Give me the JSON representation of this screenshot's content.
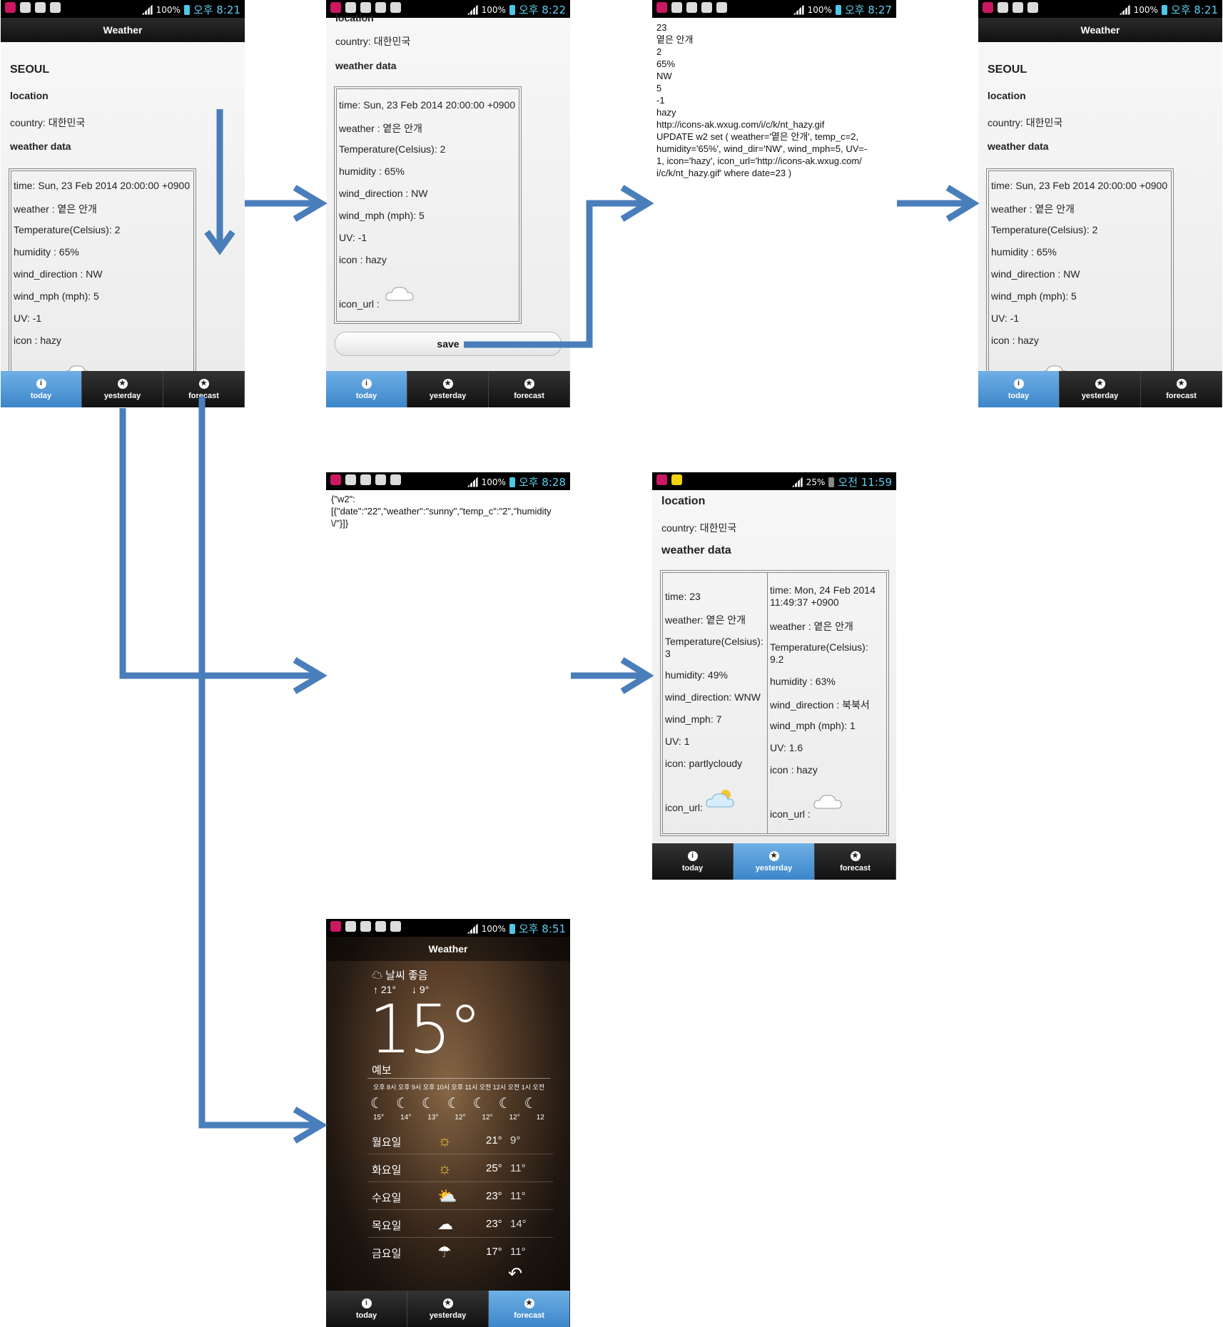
{
  "status": {
    "battery_full": "100%",
    "battery_low": "25%",
    "time_821": "오후 8:21",
    "time_822": "오후 8:22",
    "time_827": "오후 8:27",
    "time_828": "오후 8:28",
    "time_1159": "오전 11:59",
    "time_851": "오후 8:51"
  },
  "app": {
    "title": "Weather"
  },
  "tabs": {
    "today": "today",
    "yesterday": "yesterday",
    "forecast": "forecast"
  },
  "screen1": {
    "city": "SEOUL",
    "location": "location",
    "country": "country: 대한민국",
    "weather_data": "weather data",
    "rows": [
      "time: Sun, 23 Feb 2014 20:00:00 +0900",
      "weather : 옅은 안개",
      "Temperature(Celsius): 2",
      "humidity : 65%",
      "wind_direction : NW",
      "wind_mph (mph): 5",
      "UV: -1",
      "icon : hazy"
    ]
  },
  "screen2": {
    "location_partial": "location",
    "country": "country: 대한민국",
    "weather_data": "weather data",
    "rows": [
      "time: Sun, 23 Feb 2014 20:00:00 +0900",
      "weather : 옅은 안개",
      "Temperature(Celsius): 2",
      "humidity : 65%",
      "wind_direction : NW",
      "wind_mph (mph): 5",
      "UV: -1",
      "icon : hazy",
      "icon_url :"
    ],
    "save": "save"
  },
  "screen3": {
    "lines": [
      "23",
      "옅은 안개",
      "2",
      "65%",
      "NW",
      "5",
      "-1",
      "hazy",
      "http://icons-ak.wxug.com/i/c/k/nt_hazy.gif",
      "UPDATE w2 set ( weather='옅은 안개', temp_c=2,",
      "humidity='65%', wind_dir='NW', wind_mph=5, UV=-",
      "1, icon='hazy', icon_url='http://icons-ak.wxug.com/",
      "i/c/k/nt_hazy.gif' where date=23 )"
    ]
  },
  "screen4": {
    "city": "SEOUL",
    "location": "location",
    "country": "country: 대한민국",
    "weather_data": "weather data",
    "rows": [
      "time: Sun, 23 Feb 2014 20:00:00 +0900",
      "weather : 옅은 안개",
      "Temperature(Celsius): 2",
      "humidity : 65%",
      "wind_direction : NW",
      "wind_mph (mph): 5",
      "UV: -1",
      "icon : hazy"
    ]
  },
  "screen5": {
    "json_lines": [
      "{\"w2\":",
      "[{\"date\":\"22\",\"weather\":\"sunny\",\"temp_c\":\"2\",\"humidity",
      "\\/\"}]}"
    ]
  },
  "screen6": {
    "location": "location",
    "country": "country: 대한민국",
    "weather_data": "weather data",
    "left": [
      "time: 23",
      "weather: 옅은 안개",
      "Temperature(Celsius):",
      "3",
      "humidity: 49%",
      "wind_direction: WNW",
      "wind_mph: 7",
      "UV: 1",
      "icon: partlycloudy",
      "icon_url:"
    ],
    "right": [
      "time: Mon, 24 Feb 2014",
      "11:49:37 +0900",
      "weather : 옅은 안개",
      "Temperature(Celsius):",
      "9.2",
      "humidity : 63%",
      "wind_direction : 북북서",
      "wind_mph (mph): 1",
      "UV: 1.6",
      "icon : hazy",
      "icon_url :"
    ]
  },
  "screen7": {
    "title": "Weather",
    "condition": "날씨 좋음",
    "high": "21°",
    "low": "9°",
    "temp": "15°",
    "forecast_label": "예보",
    "hours": "오후 8시 오후 9시 오후 10시 오후 11시 오전 12시 오전 1시 오전",
    "hour_temps": [
      "15°",
      "14°",
      "13°",
      "12°",
      "12°",
      "12°",
      "12"
    ],
    "days": [
      {
        "day": "월요일",
        "icon": "sun-icon",
        "high": "21°",
        "low": "9°"
      },
      {
        "day": "화요일",
        "icon": "sun-icon",
        "high": "25°",
        "low": "11°"
      },
      {
        "day": "수요일",
        "icon": "partly-cloudy-icon",
        "high": "23°",
        "low": "11°"
      },
      {
        "day": "목요일",
        "icon": "cloud-icon",
        "high": "23°",
        "low": "14°"
      },
      {
        "day": "금요일",
        "icon": "rain-icon",
        "high": "17°",
        "low": "11°"
      }
    ]
  }
}
